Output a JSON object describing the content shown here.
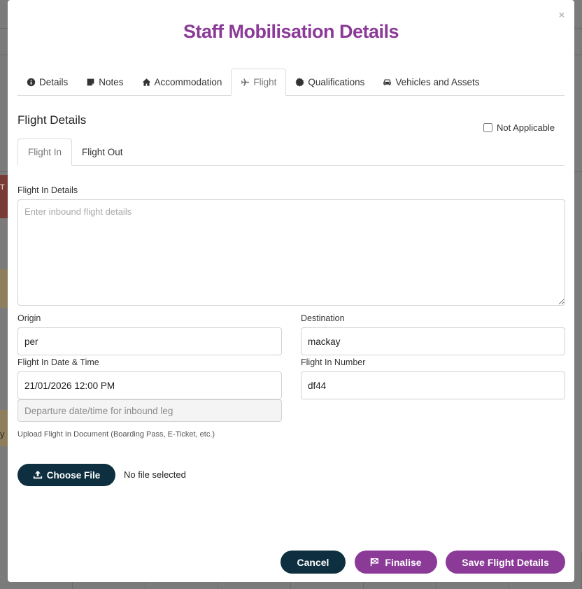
{
  "modal": {
    "title": "Staff Mobilisation Details",
    "close_symbol": "×"
  },
  "main_tabs": [
    {
      "label": "Details",
      "icon": "info-circle-icon"
    },
    {
      "label": "Notes",
      "icon": "sticky-note-icon"
    },
    {
      "label": "Accommodation",
      "icon": "home-icon"
    },
    {
      "label": "Flight",
      "icon": "plane-icon",
      "active": true
    },
    {
      "label": "Qualifications",
      "icon": "certificate-icon"
    },
    {
      "label": "Vehicles and Assets",
      "icon": "car-icon"
    }
  ],
  "section": {
    "title": "Flight Details",
    "not_applicable_label": "Not Applicable",
    "not_applicable_checked": false
  },
  "sub_tabs": [
    {
      "label": "Flight In",
      "active": true
    },
    {
      "label": "Flight Out"
    }
  ],
  "form": {
    "details_label": "Flight In Details",
    "details_placeholder": "Enter inbound flight details",
    "details_value": "",
    "origin_label": "Origin",
    "origin_value": "per",
    "destination_label": "Destination",
    "destination_value": "mackay",
    "datetime_label": "Flight In Date & Time",
    "datetime_value": "21/01/2026 12:00 PM",
    "datetime_hint_placeholder": "Departure date/time for inbound leg",
    "number_label": "Flight In Number",
    "number_value": "df44",
    "upload_label": "Upload Flight In Document (Boarding Pass, E-Ticket, etc.)",
    "choose_file_label": "Choose File",
    "no_file_text": "No file selected"
  },
  "footer": {
    "cancel_label": "Cancel",
    "finalise_label": "Finalise",
    "save_label": "Save Flight Details"
  },
  "colors": {
    "brand_purple": "#8b3a98",
    "dark_navy": "#0e2f3f"
  },
  "background": {
    "left_letter_1": "T",
    "left_letter_2": "y"
  }
}
